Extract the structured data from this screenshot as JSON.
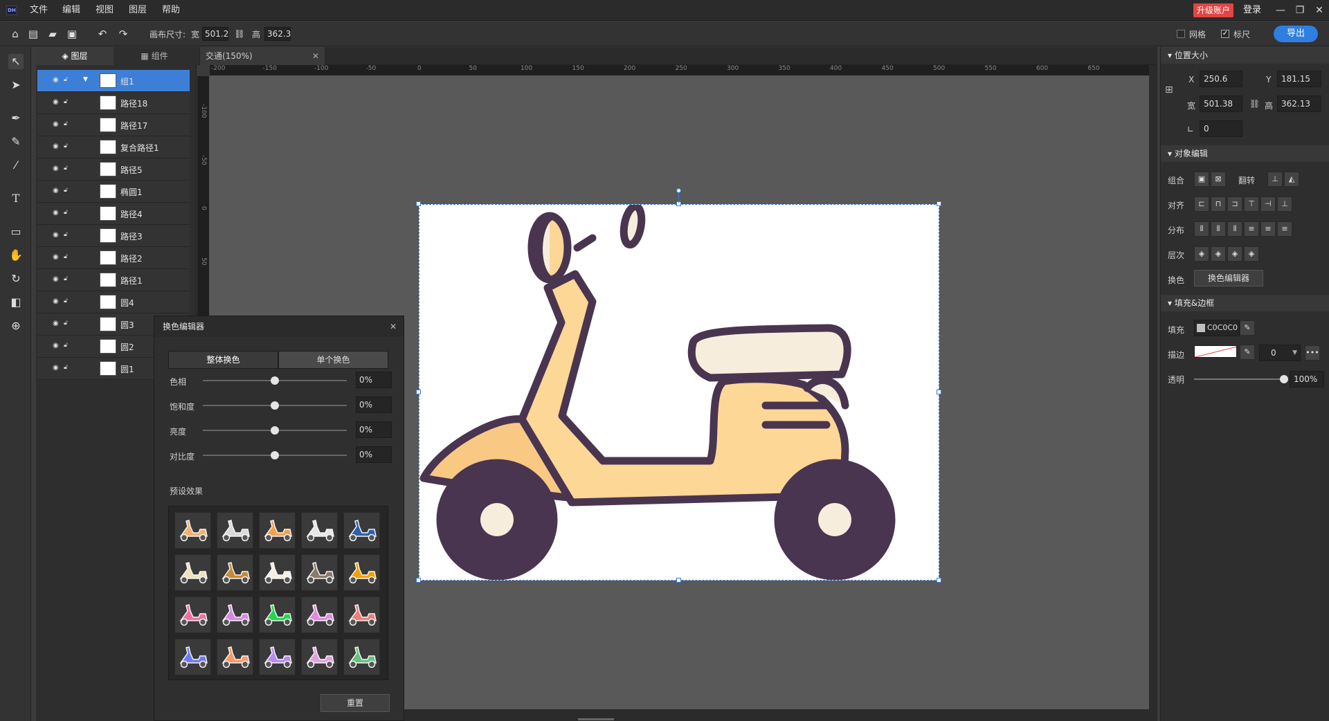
{
  "app": {
    "logo": "DH"
  },
  "menu": {
    "items": [
      "文件",
      "编辑",
      "视图",
      "图层",
      "帮助"
    ],
    "upgrade": "升级账户",
    "login": "登录"
  },
  "toolbar": {
    "canvas_size_label": "画布尺寸:",
    "width_label": "宽",
    "width_value": "501.2",
    "height_label": "高",
    "height_value": "362.3",
    "grid_label": "网格",
    "grid_checked": false,
    "ruler_label": "标尺",
    "ruler_checked": true,
    "export_label": "导出"
  },
  "layers_panel": {
    "tabs": [
      "图层",
      "组件"
    ],
    "layers": [
      {
        "name": "组1",
        "selected": true,
        "group": true
      },
      {
        "name": "路径18"
      },
      {
        "name": "路径17"
      },
      {
        "name": "复合路径1"
      },
      {
        "name": "路径5"
      },
      {
        "name": "椭圆1"
      },
      {
        "name": "路径4"
      },
      {
        "name": "路径3"
      },
      {
        "name": "路径2"
      },
      {
        "name": "路径1"
      },
      {
        "name": "圆4"
      },
      {
        "name": "圆3"
      },
      {
        "name": "圆2"
      },
      {
        "name": "圆1"
      }
    ]
  },
  "document": {
    "tab_title": "交通(150%)",
    "ruler_h": [
      "-200",
      "-150",
      "-100",
      "-50",
      "0",
      "50",
      "100",
      "150",
      "200",
      "250",
      "300",
      "350",
      "400",
      "450",
      "500",
      "550",
      "600",
      "650"
    ],
    "ruler_v": [
      "-100",
      "-50",
      "0",
      "50"
    ]
  },
  "properties": {
    "position_size": {
      "title": "位置大小",
      "x_label": "X",
      "x": "250.6",
      "y_label": "Y",
      "y": "181.15",
      "w_label": "宽",
      "w": "501.38",
      "h_label": "高",
      "h": "362.13",
      "angle": "0"
    },
    "object_edit": {
      "title": "对象编辑",
      "group_label": "组合",
      "flip_label": "翻转",
      "align_label": "对齐",
      "distribute_label": "分布",
      "order_label": "层次",
      "recolor_label": "换色",
      "recolor_button": "换色编辑器"
    },
    "fill_border": {
      "title": "填充&边框",
      "fill_label": "填充",
      "fill_value": "C0C0C0",
      "stroke_label": "描边",
      "stroke_width": "0",
      "opacity_label": "透明",
      "opacity_value": "100%",
      "opacity_level": 1.0
    }
  },
  "recolor_dialog": {
    "title": "换色编辑器",
    "mode_tabs": [
      "整体换色",
      "单个换色"
    ],
    "sliders": [
      {
        "label": "色相",
        "value": "0%",
        "level": 0.5
      },
      {
        "label": "饱和度",
        "value": "0%",
        "level": 0.5
      },
      {
        "label": "亮度",
        "value": "0%",
        "level": 0.5
      },
      {
        "label": "对比度",
        "value": "0%",
        "level": 0.5
      }
    ],
    "presets_label": "预设效果",
    "reset_label": "重置",
    "preset_colors": [
      [
        "#f3b26b",
        "#d9d9d9",
        "#f0a050",
        "#e6e6e6",
        "#2b5fb0"
      ],
      [
        "#efe2b8",
        "#c58a3a",
        "#f5efe0",
        "#8a7a6a",
        "#f5a000"
      ],
      [
        "#f06fa0",
        "#d888e0",
        "#1ed84a",
        "#e08ae0",
        "#f07b7b"
      ],
      [
        "#6f7af0",
        "#f59a6a",
        "#b68af0",
        "#e0a0e0",
        "#6ac080"
      ]
    ]
  },
  "colors": {
    "accent": "#2f7fe0",
    "selection": "#3d7fd6",
    "scooter_outline": "#4a3550",
    "scooter_body": "#fdd796",
    "scooter_cream": "#f7eddc",
    "upgrade": "#e24545"
  }
}
